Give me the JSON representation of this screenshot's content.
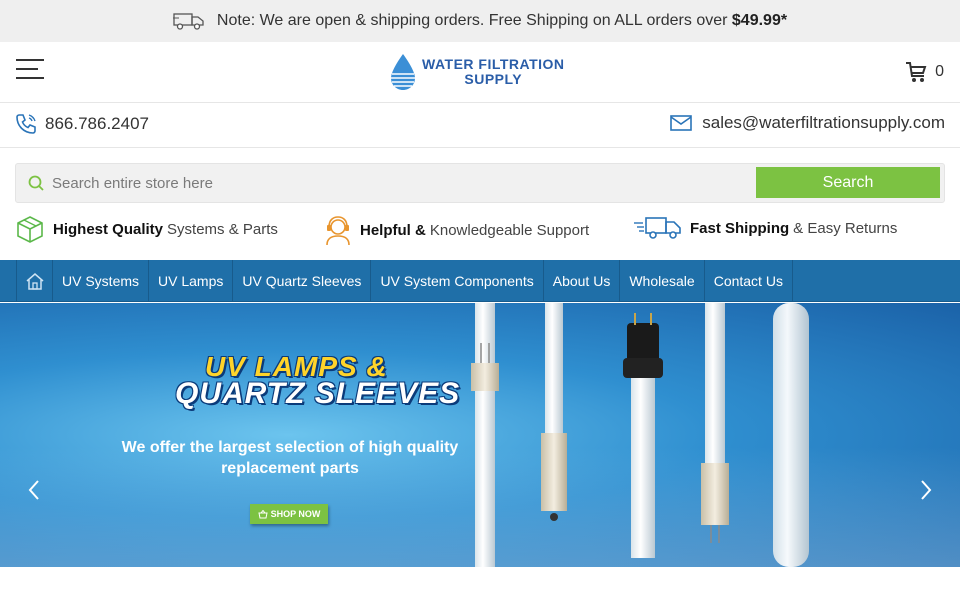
{
  "announcement": {
    "text": "Note: We are open & shipping orders. Free Shipping on ALL orders over ",
    "amount": "$49.99*"
  },
  "header": {
    "logo_line1": "WATER FILTRATION",
    "logo_line2": "SUPPLY",
    "cart_count": "0"
  },
  "contact": {
    "phone": "866.786.2407",
    "email": "sales@waterfiltrationsupply.com"
  },
  "search": {
    "placeholder": "Search entire store here",
    "button_label": "Search"
  },
  "features": [
    {
      "bold": "Highest Quality",
      "text": "Systems & Parts"
    },
    {
      "bold": "Helpful &",
      "text": "Knowledgeable Support"
    },
    {
      "bold": "Fast Shipping",
      "text": "& Easy Returns"
    }
  ],
  "nav": {
    "items": [
      "UV Systems",
      "UV Lamps",
      "UV Quartz Sleeves",
      "UV System Components",
      "About Us",
      "Wholesale",
      "Contact Us"
    ]
  },
  "hero": {
    "title_line1": "UV LAMPS &",
    "title_line2": "QUARTZ SLEEVES",
    "subtitle_line1": "We offer the largest selection of high quality",
    "subtitle_line2": "replacement parts",
    "cta": "SHOP NOW"
  },
  "colors": {
    "accent_green": "#7cc242",
    "nav_blue": "#1f6fa8",
    "feature_orange": "#e8952e",
    "feature_green": "#5bb84a",
    "feature_blue": "#2a74b8"
  }
}
